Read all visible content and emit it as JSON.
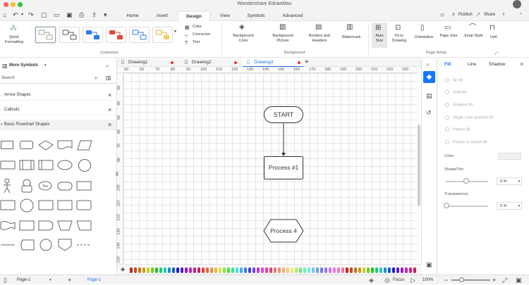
{
  "app_title": "Wondershare EdrawMax",
  "menu_tabs": [
    "Home",
    "Insert",
    "Design",
    "View",
    "Symbols",
    "Advanced"
  ],
  "active_menu_tab": "Design",
  "top_right": {
    "publish": "Publish",
    "share": "Share"
  },
  "ribbon": {
    "quick_formatting": "Quick Formatting",
    "color": "Color",
    "connector": "Connector",
    "text": "Text",
    "customize_label": "Customize",
    "background_color": "Background Color",
    "background_picture": "Background Picture",
    "borders_headers": "Borders and Headers",
    "watermark": "Watermark",
    "background_label": "Background",
    "auto_size": "Auto Size",
    "fit_to_drawing": "Fit to Drawing",
    "orientation": "Orientation",
    "page_size": "Page Size",
    "jump_style": "Jump Style",
    "unit": "Unit",
    "page_setup_label": "Page Setup"
  },
  "doc_tabs": [
    {
      "label": "Drawing1"
    },
    {
      "label": "Drawing2"
    },
    {
      "label": "Drawing3"
    }
  ],
  "active_doc_tab": "Drawing3",
  "sidebar": {
    "title": "More Symbols",
    "search_placeholder": "Search",
    "categories": [
      "Arrow Shapes",
      "Callouts",
      "Basic Flowchart Shapes"
    ]
  },
  "ruler_h": [
    "50",
    "60",
    "70",
    "80",
    "90",
    "100",
    "110",
    "120",
    "130",
    "140",
    "150",
    "160",
    "170",
    "180",
    "190",
    "200",
    "210",
    "220",
    "230",
    "240"
  ],
  "ruler_v": [
    "30",
    "40",
    "50",
    "60",
    "70",
    "80",
    "90",
    "100",
    "110",
    "120",
    "130",
    "140",
    "150",
    "160"
  ],
  "canvas": {
    "shapes": [
      {
        "text": "START"
      },
      {
        "text": "Process #1"
      },
      {
        "text": "Process 4"
      }
    ]
  },
  "right_panel": {
    "tabs": [
      "Fill",
      "Line",
      "Shadow"
    ],
    "active_tab": "Fill",
    "fill_options": [
      "No fill",
      "Solid fill",
      "Gradient fill",
      "Single color gradient fill",
      "Pattern fill",
      "Picture or texture fill"
    ],
    "color_label": "Color:",
    "shade_label": "Shade/Tint:",
    "shade_value": "0 %",
    "transparency_label": "Transparency:",
    "transparency_value": "0 %"
  },
  "status": {
    "page_selector": "Page-1",
    "page_tab": "Page-1",
    "focus": "Focus",
    "zoom": "100%"
  },
  "colors": {
    "accent": "#1677ff",
    "active_tab_text": "#1a6fe0",
    "tab_dot": "#e33"
  }
}
